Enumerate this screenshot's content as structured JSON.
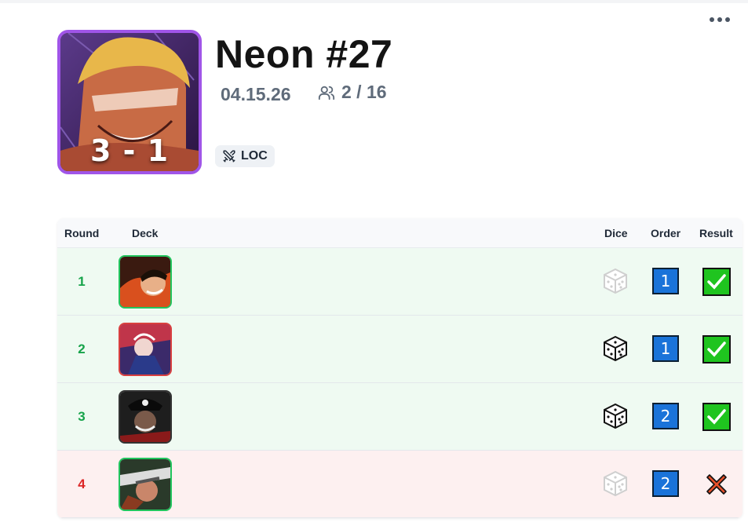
{
  "tournament": {
    "title": "Neon #27",
    "date": "04.15.26",
    "players": "2 / 16",
    "record": "3 - 1",
    "format": "LOC",
    "accent_color": "#a055e8",
    "players_icon": "users-icon",
    "format_icon": "crossed-swords-icon",
    "menu_icon": "more-horizontal-icon"
  },
  "table": {
    "headers": {
      "round": "Round",
      "deck": "Deck",
      "dice": "Dice",
      "order": "Order",
      "result": "Result"
    },
    "rows": [
      {
        "round": "1",
        "dice": "dice-icon",
        "order": "1",
        "result": "win"
      },
      {
        "round": "2",
        "dice": "dice-icon",
        "order": "1",
        "result": "win"
      },
      {
        "round": "3",
        "dice": "dice-icon",
        "order": "2",
        "result": "win"
      },
      {
        "round": "4",
        "dice": "dice-icon",
        "order": "2",
        "result": "loss"
      }
    ]
  },
  "colors": {
    "win_text": "#16a34a",
    "loss_text": "#dc2626",
    "win_row": "#effaf2",
    "loss_row": "#fdf0f0",
    "order_box": "#1a73d9",
    "check_box": "#1fc41f",
    "loss_mark": "#e8502a"
  }
}
